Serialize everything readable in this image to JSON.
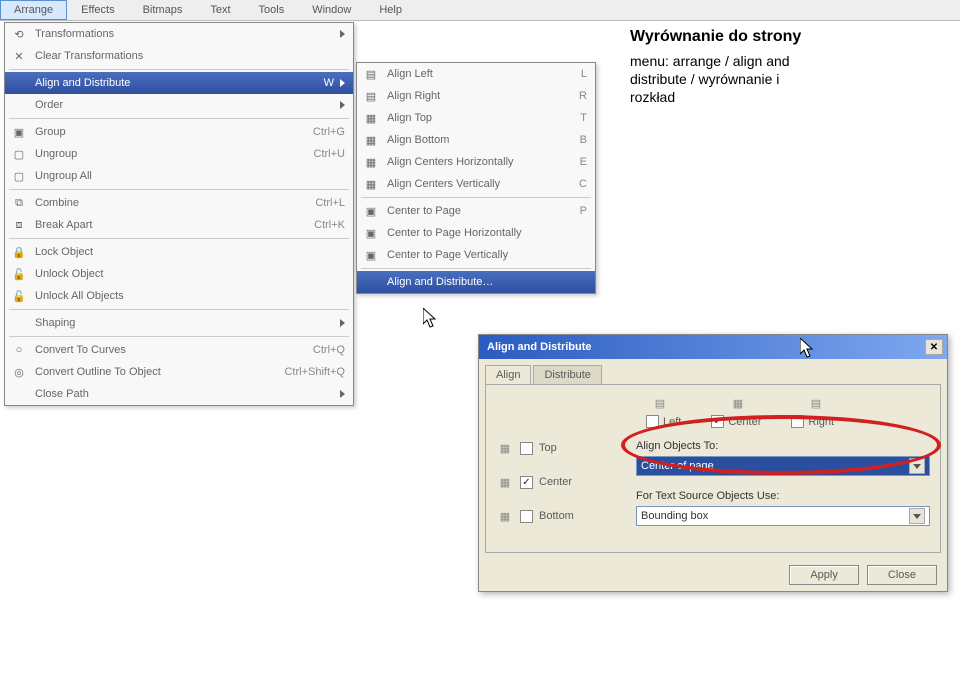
{
  "menubar": [
    "Arrange",
    "Effects",
    "Bitmaps",
    "Text",
    "Tools",
    "Window",
    "Help"
  ],
  "arrange_menu": {
    "transformations": "Transformations",
    "clear_transformations": "Clear Transformations",
    "align_distribute": "Align and Distribute",
    "align_shortcut": "W",
    "order": "Order",
    "group": "Group",
    "group_sc": "Ctrl+G",
    "ungroup": "Ungroup",
    "ungroup_sc": "Ctrl+U",
    "ungroup_all": "Ungroup All",
    "combine": "Combine",
    "combine_sc": "Ctrl+L",
    "break_apart": "Break Apart",
    "break_sc": "Ctrl+K",
    "lock": "Lock Object",
    "unlock": "Unlock Object",
    "unlock_all": "Unlock All Objects",
    "shaping": "Shaping",
    "curves": "Convert To Curves",
    "curves_sc": "Ctrl+Q",
    "outline": "Convert Outline To Object",
    "outline_sc": "Ctrl+Shift+Q",
    "close_path": "Close Path"
  },
  "align_submenu": {
    "left": "Align Left",
    "left_sc": "L",
    "right": "Align Right",
    "right_sc": "R",
    "top": "Align Top",
    "top_sc": "T",
    "bottom": "Align Bottom",
    "bottom_sc": "B",
    "centers_h": "Align Centers Horizontally",
    "centers_h_sc": "E",
    "centers_v": "Align Centers Vertically",
    "centers_v_sc": "C",
    "center_page": "Center to Page",
    "center_page_sc": "P",
    "center_page_h": "Center to Page Horizontally",
    "center_page_v": "Center to Page Vertically",
    "align_and_distribute": "Align and Distribute…"
  },
  "dialog": {
    "title": "Align and Distribute",
    "tabs": [
      "Align",
      "Distribute"
    ],
    "h": {
      "left": "Left",
      "center": "Center",
      "right": "Right"
    },
    "v": {
      "top": "Top",
      "center": "Center",
      "bottom": "Bottom"
    },
    "align_to_label": "Align Objects To:",
    "align_to_value": "Center of page",
    "text_src_label": "For Text Source Objects Use:",
    "text_src_value": "Bounding box",
    "apply": "Apply",
    "close": "Close"
  },
  "annotation": {
    "title": "Wyrównanie do strony",
    "body1": "menu: arrange / align and",
    "body2": "distribute / wyrównanie i",
    "body3": "rozkład"
  }
}
